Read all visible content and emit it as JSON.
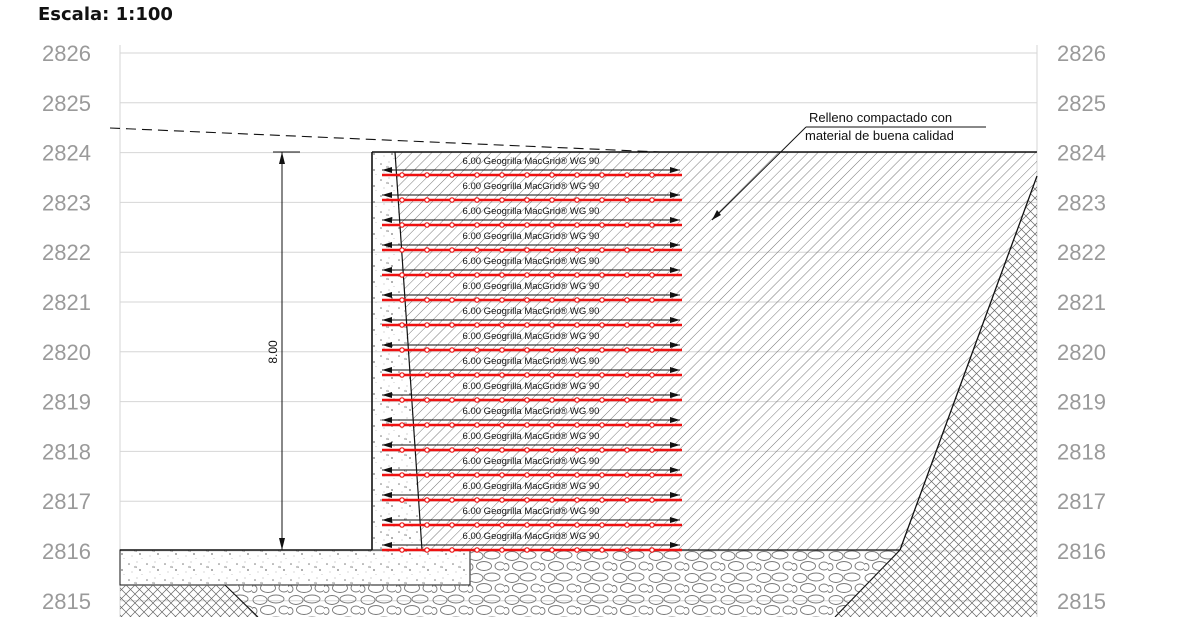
{
  "title": "Escala: 1:100",
  "elevations": [
    "2826",
    "2825",
    "2824",
    "2823",
    "2822",
    "2821",
    "2820",
    "2819",
    "2818",
    "2817",
    "2816",
    "2815"
  ],
  "wall_height_label": "8.00",
  "callout": {
    "line1": "Relleno compactado con",
    "line2": "material de buena calidad"
  },
  "geogrid_layers": [
    "6.00 Geogrilla MacGrid® WG 90",
    "6.00 Geogrilla MacGrid® WG 90",
    "6.00 Geogrilla MacGrid® WG 90",
    "6.00 Geogrilla MacGrid® WG 90",
    "6.00 Geogrilla MacGrid® WG 90",
    "6.00 Geogrilla MacGrid® WG 90",
    "6.00 Geogrilla MacGrid® WG 90",
    "6.00 Geogrilla MacGrid® WG 90",
    "6.00 Geogrilla MacGrid® WG 90",
    "6.00 Geogrilla MacGrid® WG 90",
    "6.00 Geogrilla MacGrid® WG 90",
    "6.00 Geogrilla MacGrid® WG 90",
    "6.00 Geogrilla MacGrid® WG 90",
    "6.00 Geogrilla MacGrid® WG 90",
    "6.00 Geogrilla MacGrid® WG 90",
    "6.00 Geogrilla MacGrid® WG 90"
  ],
  "colors": {
    "geogrid": "#ee1111",
    "grid": "#d6d6d6",
    "elevation_text": "#9a9a9a",
    "line": "#111111"
  }
}
